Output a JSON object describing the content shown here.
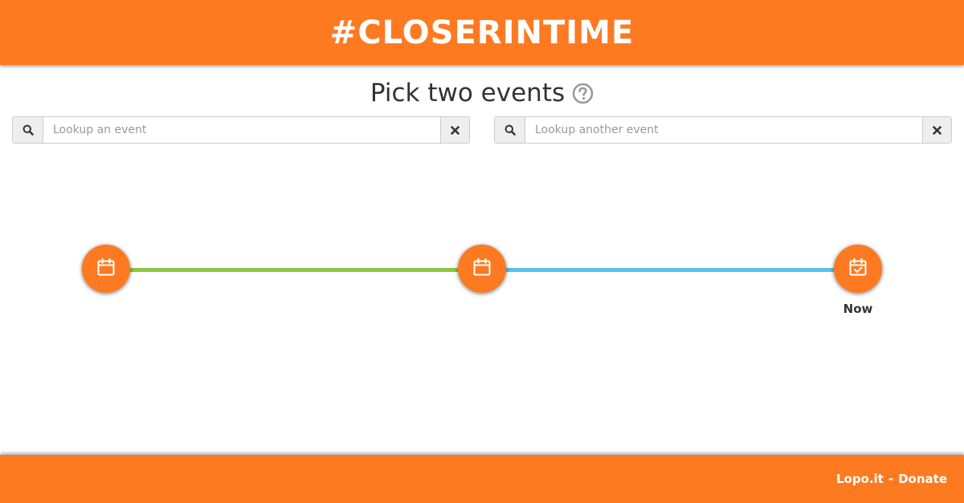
{
  "header": {
    "title": "#CLOSERINTIME"
  },
  "heading": {
    "text": "Pick two events",
    "help_icon": "question-circle-icon"
  },
  "search_first": {
    "placeholder": "Lookup an event",
    "value": "",
    "search_icon": "search-icon",
    "clear_icon": "close-icon"
  },
  "search_second": {
    "placeholder": "Lookup another event",
    "value": "",
    "search_icon": "search-icon",
    "clear_icon": "close-icon"
  },
  "timeline": {
    "nodes": [
      {
        "icon": "calendar-icon",
        "label": ""
      },
      {
        "icon": "calendar-icon",
        "label": ""
      },
      {
        "icon": "calendar-check-icon",
        "label": "Now"
      }
    ],
    "segment_colors": [
      "#8dc63f",
      "#5bc0eb"
    ]
  },
  "footer": {
    "link_site": "Lopo.it",
    "separator": "-",
    "link_donate": "Donate"
  },
  "colors": {
    "brand": "#fd7a21",
    "green": "#8dc63f",
    "blue": "#5bc0eb"
  }
}
